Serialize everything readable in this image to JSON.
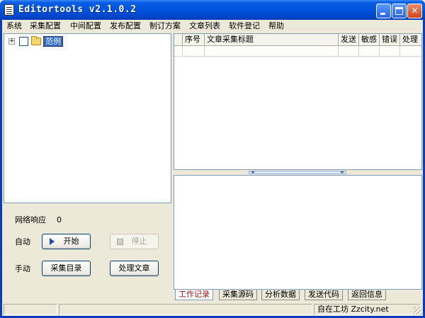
{
  "window": {
    "title": "Editortools v2.1.0.2"
  },
  "menu": [
    "系统",
    "采集配置",
    "中间配置",
    "发布配置",
    "制订方案",
    "文章列表",
    "软件登记",
    "帮助"
  ],
  "tree": {
    "expander": "+",
    "node_label": "范例"
  },
  "controls": {
    "network_label": "网络响应",
    "network_value": "0",
    "auto_label": "自动",
    "start_label": "开始",
    "stop_label": "停止",
    "manual_label": "手动",
    "collect_dir_label": "采集目录",
    "process_article_label": "处理文章"
  },
  "table": {
    "columns": [
      "序号",
      "文章采集标题",
      "发送",
      "敏感",
      "错误",
      "处理"
    ]
  },
  "tabs": [
    "工作记录",
    "采集源码",
    "分析数据",
    "发送代码",
    "返回信息"
  ],
  "status": {
    "text": "自在工坊  Zzcity.net"
  }
}
